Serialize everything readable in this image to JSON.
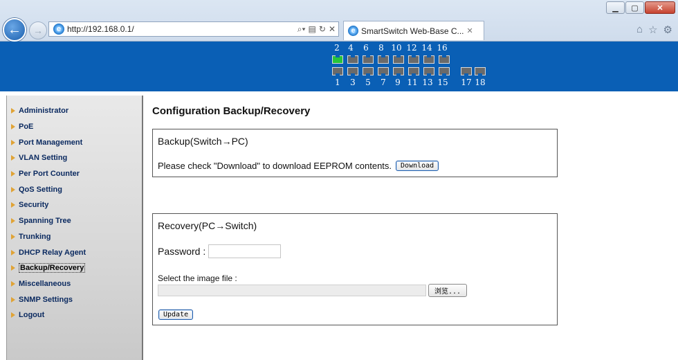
{
  "browser": {
    "url": "http://192.168.0.1/",
    "tab_title": "SmartSwitch Web-Base C..."
  },
  "ports": {
    "top_labels": [
      "2",
      "4",
      "6",
      "8",
      "10",
      "12",
      "14",
      "16"
    ],
    "bottom_labels": [
      "1",
      "3",
      "5",
      "7",
      "9",
      "11",
      "13",
      "15"
    ],
    "extra_labels": [
      "17",
      "18"
    ],
    "active_port": "2",
    "colors": {
      "active": "#27c53b",
      "inactive": "#6a6a6a",
      "banner": "#0a5fb5"
    }
  },
  "sidebar": {
    "items": [
      {
        "label": "Administrator"
      },
      {
        "label": "PoE"
      },
      {
        "label": "Port Management"
      },
      {
        "label": "VLAN Setting"
      },
      {
        "label": "Per Port Counter"
      },
      {
        "label": "QoS Setting"
      },
      {
        "label": "Security"
      },
      {
        "label": "Spanning Tree"
      },
      {
        "label": "Trunking"
      },
      {
        "label": "DHCP Relay Agent"
      },
      {
        "label": "Backup/Recovery"
      },
      {
        "label": "Miscellaneous"
      },
      {
        "label": "SNMP Settings"
      },
      {
        "label": "Logout"
      }
    ],
    "active": "Backup/Recovery"
  },
  "page": {
    "title": "Configuration Backup/Recovery",
    "backup": {
      "heading": "Backup(Switch→PC)",
      "text": "Please check \"Download\" to download EEPROM contents.",
      "button": "Download"
    },
    "recovery": {
      "heading": "Recovery(PC→Switch)",
      "password_label": "Password :",
      "password_value": "",
      "file_label": "Select the image file :",
      "browse_button": "浏览...",
      "update_button": "Update"
    }
  }
}
